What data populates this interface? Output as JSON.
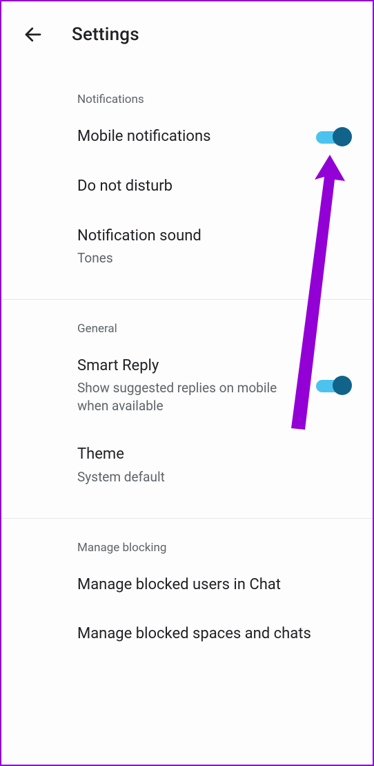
{
  "header": {
    "title": "Settings"
  },
  "sections": {
    "notifications": {
      "header": "Notifications",
      "mobile_notifications": {
        "label": "Mobile notifications",
        "toggle": true
      },
      "do_not_disturb": {
        "label": "Do not disturb"
      },
      "notification_sound": {
        "label": "Notification sound",
        "sub": "Tones"
      }
    },
    "general": {
      "header": "General",
      "smart_reply": {
        "label": "Smart Reply",
        "sub": "Show suggested replies on mobile when available",
        "toggle": true
      },
      "theme": {
        "label": "Theme",
        "sub": "System default"
      }
    },
    "manage_blocking": {
      "header": "Manage blocking",
      "blocked_users": {
        "label": "Manage blocked users in Chat"
      },
      "blocked_spaces": {
        "label": "Manage blocked spaces and chats"
      }
    }
  },
  "annotation": {
    "arrow_color": "#9200d6"
  }
}
